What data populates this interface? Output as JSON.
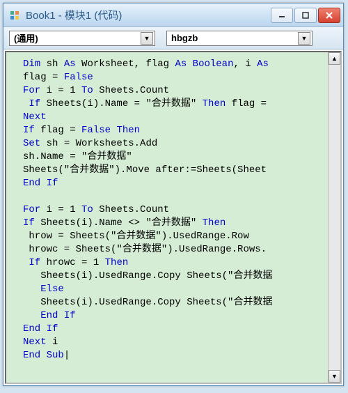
{
  "title": "Book1 - 模块1 (代码)",
  "combo_left": "(通用)",
  "combo_right": "hbgzb",
  "code_lines": [
    [
      [
        "kw",
        "Dim"
      ],
      [
        "t",
        " sh "
      ],
      [
        "kw",
        "As"
      ],
      [
        "t",
        " Worksheet, flag "
      ],
      [
        "kw",
        "As Boolean"
      ],
      [
        "t",
        ", i "
      ],
      [
        "kw",
        "As"
      ]
    ],
    [
      [
        "t",
        "flag = "
      ],
      [
        "kw",
        "False"
      ]
    ],
    [
      [
        "kw",
        "For"
      ],
      [
        "t",
        " i = 1 "
      ],
      [
        "kw",
        "To"
      ],
      [
        "t",
        " Sheets.Count"
      ]
    ],
    [
      [
        "t",
        " "
      ],
      [
        "kw",
        "If"
      ],
      [
        "t",
        " Sheets(i).Name = \"合并数据\" "
      ],
      [
        "kw",
        "Then"
      ],
      [
        "t",
        " flag ="
      ]
    ],
    [
      [
        "kw",
        "Next"
      ]
    ],
    [
      [
        "kw",
        "If"
      ],
      [
        "t",
        " flag = "
      ],
      [
        "kw",
        "False Then"
      ]
    ],
    [
      [
        "kw",
        "Set"
      ],
      [
        "t",
        " sh = Worksheets.Add"
      ]
    ],
    [
      [
        "t",
        "sh.Name = \"合并数据\""
      ]
    ],
    [
      [
        "t",
        "Sheets(\"合并数据\").Move after:=Sheets(Sheet"
      ]
    ],
    [
      [
        "kw",
        "End If"
      ]
    ],
    [
      [
        "t",
        " "
      ]
    ],
    [
      [
        "kw",
        "For"
      ],
      [
        "t",
        " i = 1 "
      ],
      [
        "kw",
        "To"
      ],
      [
        "t",
        " Sheets.Count"
      ]
    ],
    [
      [
        "kw",
        "If"
      ],
      [
        "t",
        " Sheets(i).Name <> \"合并数据\" "
      ],
      [
        "kw",
        "Then"
      ]
    ],
    [
      [
        "t",
        " hrow = Sheets(\"合并数据\").UsedRange.Row"
      ]
    ],
    [
      [
        "t",
        " hrowc = Sheets(\"合并数据\").UsedRange.Rows."
      ]
    ],
    [
      [
        "t",
        " "
      ],
      [
        "kw",
        "If"
      ],
      [
        "t",
        " hrowc = 1 "
      ],
      [
        "kw",
        "Then"
      ]
    ],
    [
      [
        "t",
        "   Sheets(i).UsedRange.Copy Sheets(\"合并数据"
      ]
    ],
    [
      [
        "t",
        "   "
      ],
      [
        "kw",
        "Else"
      ]
    ],
    [
      [
        "t",
        "   Sheets(i).UsedRange.Copy Sheets(\"合并数据"
      ]
    ],
    [
      [
        "t",
        "   "
      ],
      [
        "kw",
        "End If"
      ]
    ],
    [
      [
        "kw",
        "End If"
      ]
    ],
    [
      [
        "kw",
        "Next"
      ],
      [
        "t",
        " i"
      ]
    ],
    [
      [
        "kw",
        "End Sub"
      ],
      [
        "t",
        "|"
      ]
    ]
  ]
}
